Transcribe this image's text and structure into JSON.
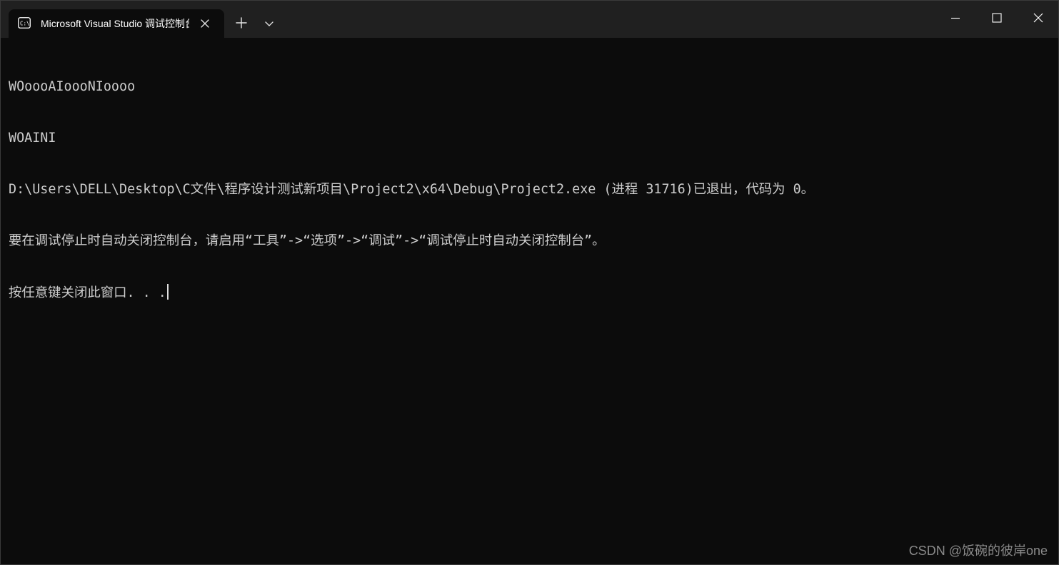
{
  "window": {
    "tab_title": "Microsoft Visual Studio 调试控制台",
    "tab_icon": "console-icon",
    "new_tab_icon": "plus-icon",
    "dropdown_icon": "chevron-down-icon",
    "caption": {
      "minimize_icon": "minimize-icon",
      "maximize_icon": "maximize-icon",
      "close_icon": "close-icon"
    }
  },
  "console": {
    "lines": [
      "WOoooAIoooNIoooo",
      "WOAINI",
      "D:\\Users\\DELL\\Desktop\\C文件\\程序设计测试新项目\\Project2\\x64\\Debug\\Project2.exe (进程 31716)已退出，代码为 0。",
      "要在调试停止时自动关闭控制台，请启用“工具”->“选项”->“调试”->“调试停止时自动关闭控制台”。",
      "按任意键关闭此窗口. . ."
    ]
  },
  "watermark": "CSDN @饭碗的彼岸one",
  "colors": {
    "background": "#0c0c0c",
    "titlebar": "#202020",
    "text": "#cccccc"
  }
}
